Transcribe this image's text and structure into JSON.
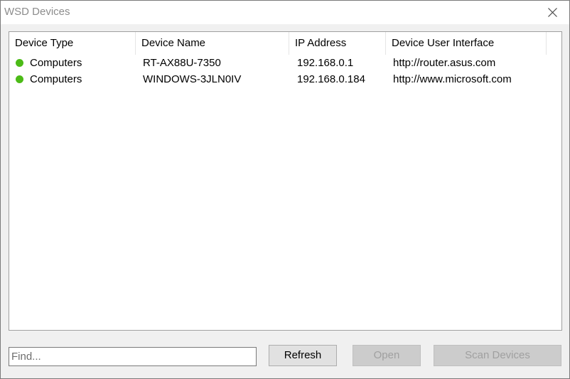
{
  "window": {
    "title": "WSD Devices"
  },
  "table": {
    "columns": [
      "Device Type",
      "Device Name",
      "IP Address",
      "Device User Interface"
    ],
    "rows": [
      {
        "status_color": "#4cbb17",
        "device_type": "Computers",
        "device_name": "RT-AX88U-7350",
        "ip_address": "192.168.0.1",
        "device_ui": "http://router.asus.com"
      },
      {
        "status_color": "#4cbb17",
        "device_type": "Computers",
        "device_name": "WINDOWS-3JLN0IV",
        "ip_address": "192.168.0.184",
        "device_ui": "http://www.microsoft.com"
      }
    ]
  },
  "footer": {
    "find_placeholder": "Find...",
    "find_value": "",
    "refresh_label": "Refresh",
    "open_label": "Open",
    "open_enabled": false,
    "scan_label": "Scan Devices",
    "scan_enabled": false
  },
  "icons": {
    "close": "close-icon",
    "status": "status-dot-icon"
  }
}
